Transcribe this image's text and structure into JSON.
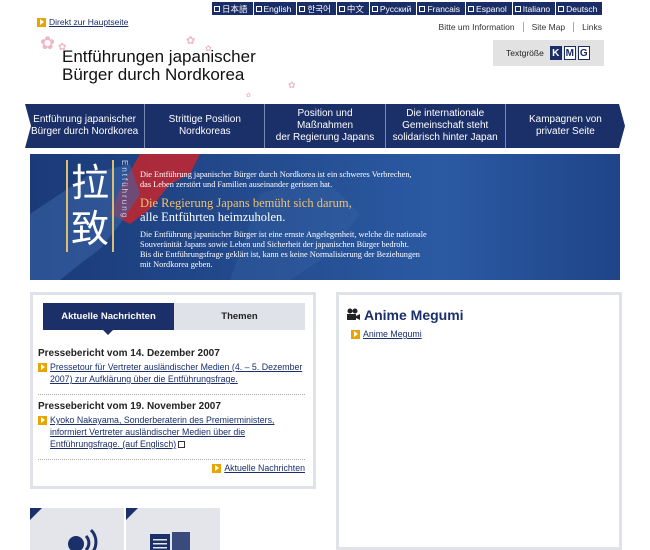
{
  "languages": [
    {
      "label": "日本語"
    },
    {
      "label": "English"
    },
    {
      "label": "한국어"
    },
    {
      "label": "中文"
    },
    {
      "label": "Русский"
    },
    {
      "label": "Francais"
    },
    {
      "label": "Espanol"
    },
    {
      "label": "Italiano"
    },
    {
      "label": "Deutsch"
    }
  ],
  "skip_link": "Direkt zur Hauptseite",
  "utility_nav": [
    "Bitte um Information",
    "Site Map",
    "Links"
  ],
  "logo": {
    "line1": "Entführungen japanischer",
    "line2": "Bürger durch Nordkorea"
  },
  "text_size": {
    "label": "Textgröße",
    "options": [
      "K",
      "M",
      "G"
    ],
    "active": "K"
  },
  "main_nav": [
    {
      "line1": "Entführung japanischer",
      "line2": "Bürger durch Nordkorea"
    },
    {
      "line1": "Strittige Position",
      "line2": "Nordkoreas"
    },
    {
      "line1": "Position und Maßnahmen",
      "line2": "der Regierung Japans"
    },
    {
      "line1": "Die internationale Gemeinschaft steht",
      "line2": "solidarisch hinter Japan"
    },
    {
      "line1": "Kampagnen von",
      "line2": "privater Seite"
    }
  ],
  "banner": {
    "kanji1": "拉",
    "kanji2": "致",
    "kanji_sub": "Entführung",
    "p1_l1": "Die Entführung japanischer Bürger durch Nordkorea ist ein schweres Verbrechen,",
    "p1_l2": "das Leben zerstört und Familien auseinander gerissen hat.",
    "head_l1": "Die Regierung Japans bemüht sich darum,",
    "head_l2": "alle Entführten heimzuholen.",
    "p2_l1": "Die Entführung japanischer Bürger ist eine ernste Angelegenheit, welche die nationale",
    "p2_l2": "Souveränität Japans  sowie Leben und Sicherheit der japanischen Bürger bedroht.",
    "p2_l3": "Bis die Entführungsfrage geklärt ist, kann es keine Normalisierung der Beziehungen",
    "p2_l4": "mit Nordkorea geben."
  },
  "tabs": [
    "Aktuelle Nachrichten",
    "Themen"
  ],
  "news": [
    {
      "date": "Pressebericht vom 14. Dezember 2007",
      "text": "Pressetour für Vertreter ausländischer Medien (4. – 5. Dezember 2007) zur Aufklärung über die Entführungsfrage."
    },
    {
      "date": "Pressebericht vom 19. November 2007",
      "text": "Kyoko Nakayama, Sonderberaterin des Premierministers, informiert Vertreter ausländischer Medien über die Entführungsfrage. (auf Englisch)"
    }
  ],
  "more_news": "Aktuelle Nachrichten",
  "anime": {
    "title": "Anime Megumi",
    "link": "Anime Megumi"
  },
  "colors": {
    "navy": "#1b2f68",
    "accent": "#e8a400",
    "blossom": "#f0b6c6"
  },
  "icons": [
    "arrow-right-icon",
    "film-camera-icon",
    "radio-antenna-icon",
    "book-icon",
    "document-icon"
  ]
}
